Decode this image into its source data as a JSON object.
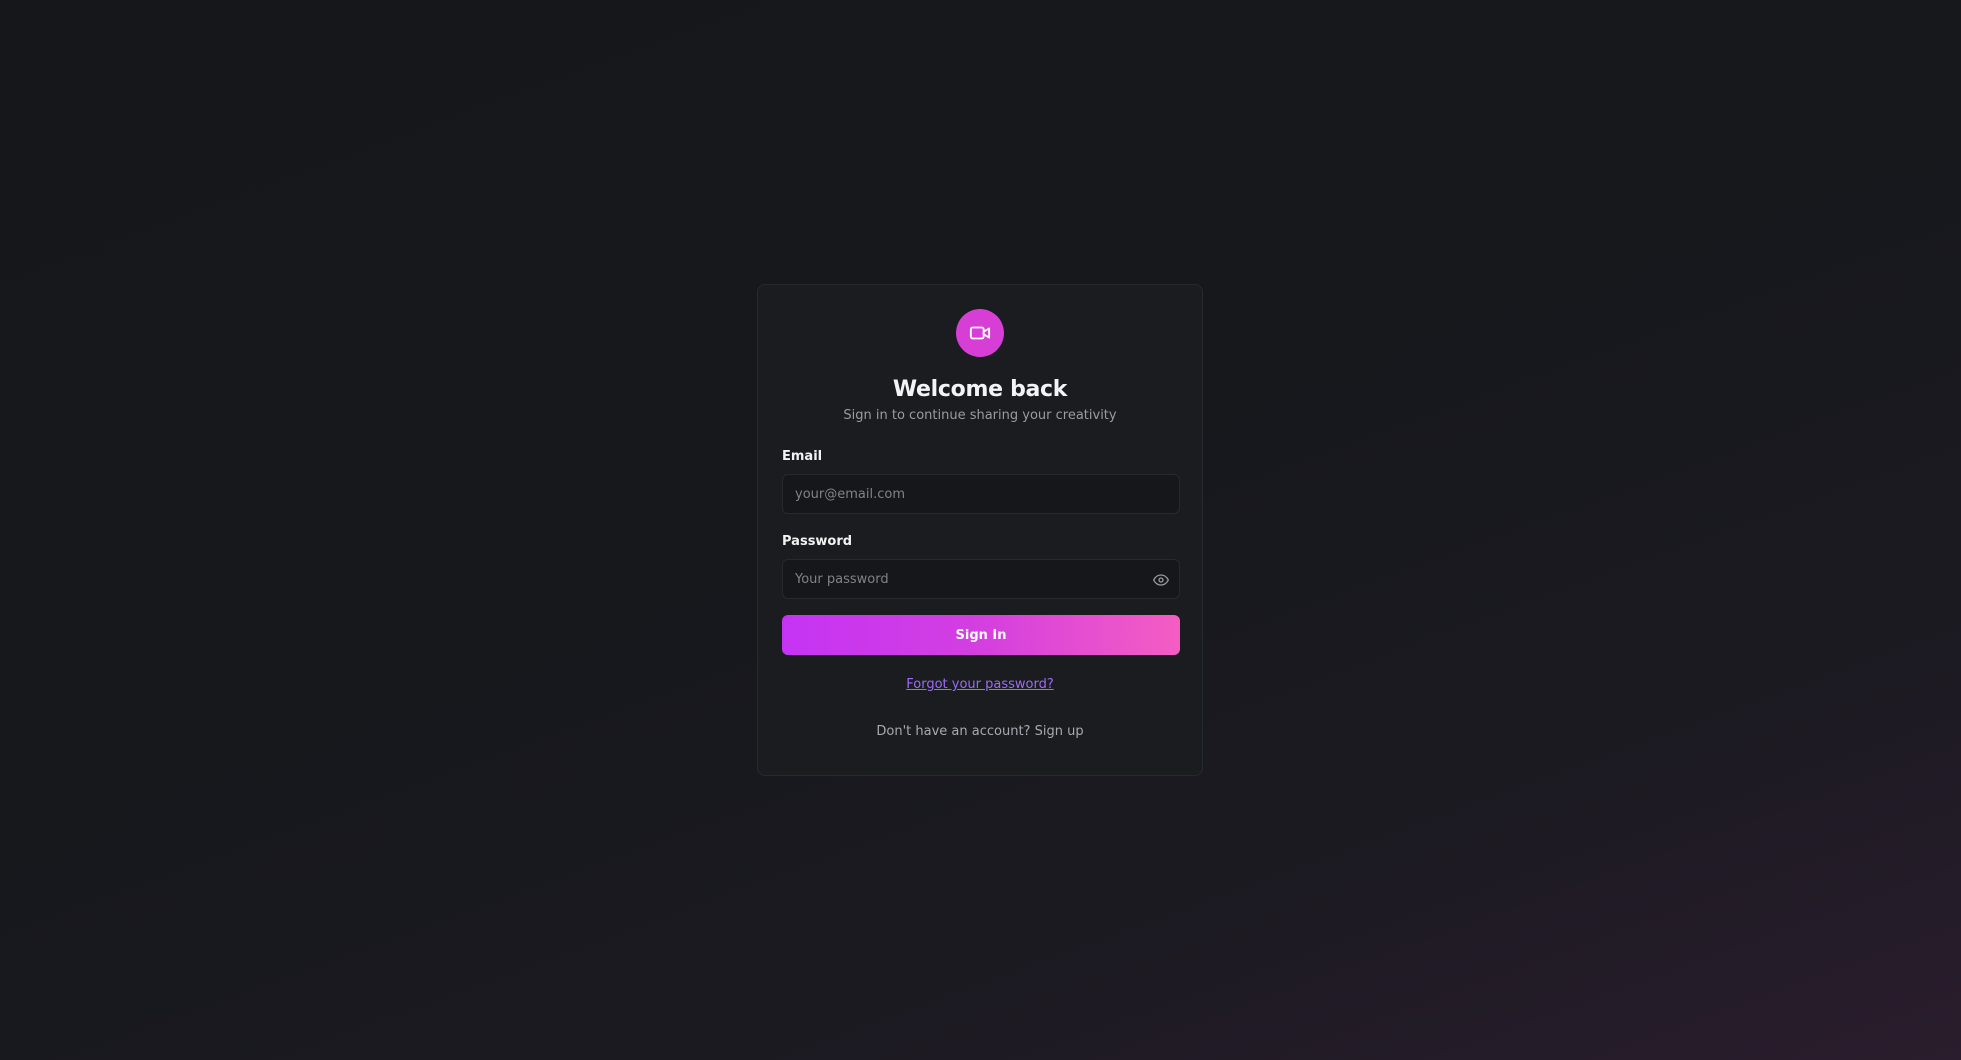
{
  "logo": {
    "icon": "video-camera-icon",
    "color": "#d63ed6"
  },
  "header": {
    "title": "Welcome back",
    "subtitle": "Sign in to continue sharing your creativity"
  },
  "form": {
    "email": {
      "label": "Email",
      "placeholder": "your@email.com",
      "value": ""
    },
    "password": {
      "label": "Password",
      "placeholder": "Your password",
      "value": "",
      "toggle_icon": "eye-icon"
    },
    "submit_label": "Sign In",
    "forgot_label": "Forgot your password?"
  },
  "footer": {
    "prompt": "Don't have an account?",
    "signup_label": "Sign up"
  },
  "colors": {
    "accent_start": "#c534f4",
    "accent_end": "#f45dc2",
    "link": "#9b6cf3"
  }
}
